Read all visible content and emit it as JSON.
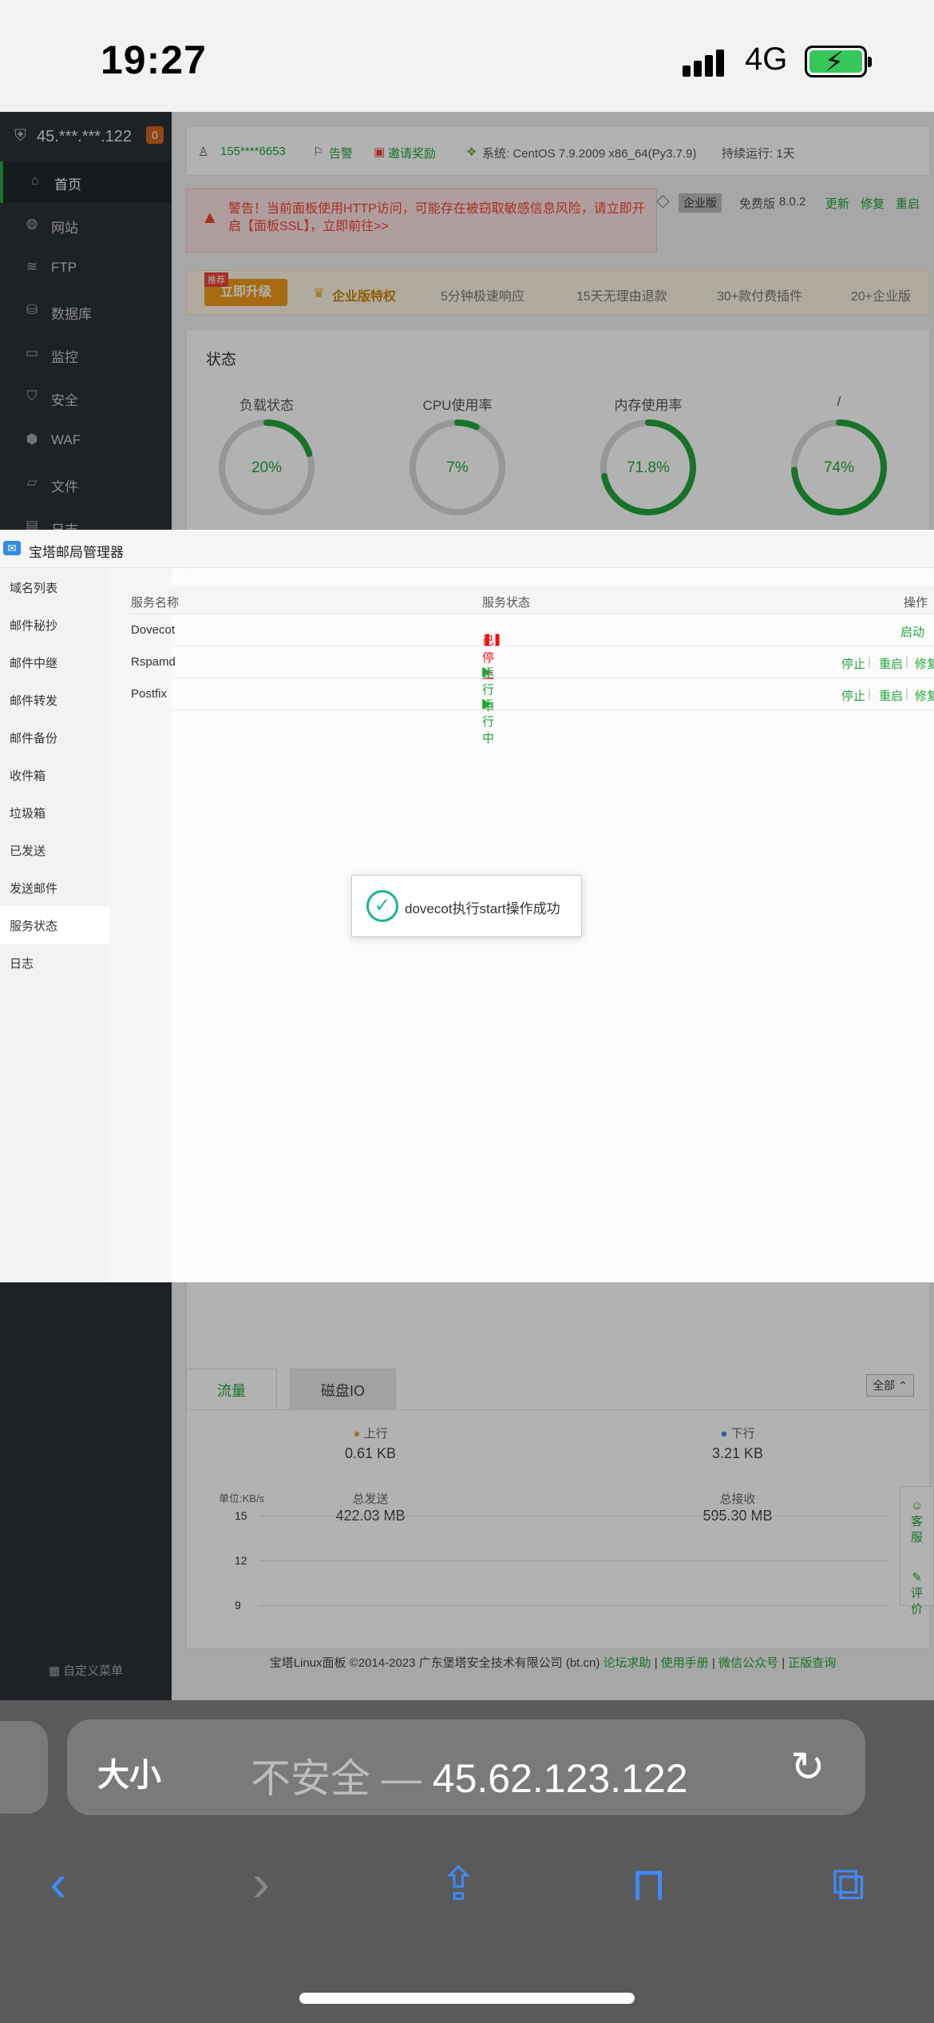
{
  "status_bar": {
    "time": "19:27",
    "network": "4G"
  },
  "sidebar": {
    "server_ip": "45.***.***.122",
    "alert_count": "0",
    "items": [
      {
        "label": "首页",
        "icon": "home-icon"
      },
      {
        "label": "网站",
        "icon": "globe-icon"
      },
      {
        "label": "FTP",
        "icon": "ftp-icon"
      },
      {
        "label": "数据库",
        "icon": "database-icon"
      },
      {
        "label": "监控",
        "icon": "monitor-icon"
      },
      {
        "label": "安全",
        "icon": "shield-icon"
      },
      {
        "label": "WAF",
        "icon": "waf-icon"
      },
      {
        "label": "文件",
        "icon": "folder-icon"
      },
      {
        "label": "日志",
        "icon": "log-icon"
      }
    ],
    "footer": "自定义菜单"
  },
  "topinfo": {
    "user": "155****6653",
    "alarm": "告警",
    "invite": "邀请奖励",
    "system": "系统:  CentOS 7.9.2009 x86_64(Py3.7.9)",
    "uptime": "持续运行: 1天"
  },
  "warning": {
    "text": "警告！当前面板使用HTTP访问，可能存在被窃取敏感信息风险，请立即开启【面板SSL】，立即前往>>"
  },
  "version": {
    "edition": "企业版",
    "free": "免费版",
    "number": "8.0.2",
    "update": "更新",
    "repair": "修复",
    "restart": "重启"
  },
  "upgrade": {
    "button": "立即升级",
    "tag": "推荐",
    "feature_title": "企业版特权",
    "f1": "5分钟极速响应",
    "f2": "15天无理由退款",
    "f3": "30+款付费插件",
    "f4": "20+企业版"
  },
  "status": {
    "title": "状态",
    "gauges": [
      {
        "label": "负载状态",
        "value": "20%",
        "pct": 20
      },
      {
        "label": "CPU使用率",
        "value": "7%",
        "pct": 7
      },
      {
        "label": "内存使用率",
        "value": "71.8%",
        "pct": 71.8
      },
      {
        "label": "/",
        "value": "74%",
        "pct": 74
      }
    ]
  },
  "traffic": {
    "tab_flow": "流量",
    "tab_disk": "磁盘IO",
    "filter": "全部",
    "up_label": "上行",
    "up_value": "0.61 KB",
    "down_label": "下行",
    "down_value": "3.21 KB",
    "unit": "单位:KB/s",
    "sent_label": "总发送",
    "sent_value": "422.03 MB",
    "recv_label": "总接收",
    "recv_value": "595.30 MB",
    "ticks": [
      "15",
      "12",
      "9"
    ]
  },
  "side_help": {
    "service": "客服",
    "review": "评价"
  },
  "footer": {
    "copyright": "宝塔Linux面板 ©2014-2023 广东堡塔安全技术有限公司 (bt.cn)",
    "l1": "论坛求助",
    "l2": "使用手册",
    "l3": "微信公众号",
    "l4": "正版查询"
  },
  "mail": {
    "title": "宝塔邮局管理器",
    "nav": [
      "域名列表",
      "邮件秘抄",
      "邮件中继",
      "邮件转发",
      "邮件备份",
      "收件箱",
      "垃圾箱",
      "已发送",
      "发送邮件",
      "服务状态",
      "日志"
    ],
    "table": {
      "headers": {
        "name": "服务名称",
        "status": "服务状态",
        "ops": "操作"
      },
      "rows": [
        {
          "name": "Dovecot",
          "status": "已停止",
          "ops": [
            "启动"
          ]
        },
        {
          "name": "Rspamd",
          "status": "运行中",
          "ops": [
            "停止",
            "重启",
            "修复"
          ]
        },
        {
          "name": "Postfix",
          "status": "运行中",
          "ops": [
            "停止",
            "重启",
            "修复"
          ]
        }
      ]
    }
  },
  "toast": {
    "message": "dovecot执行start操作成功"
  },
  "browser": {
    "aa": "大小",
    "not_secure": "不安全",
    "dash": " — ",
    "host": "45.62.123.122"
  },
  "colors": {
    "accent": "#20a53a",
    "danger": "#e11111",
    "sidebar": "#2b3036",
    "ios_blue": "#3d8bff"
  }
}
